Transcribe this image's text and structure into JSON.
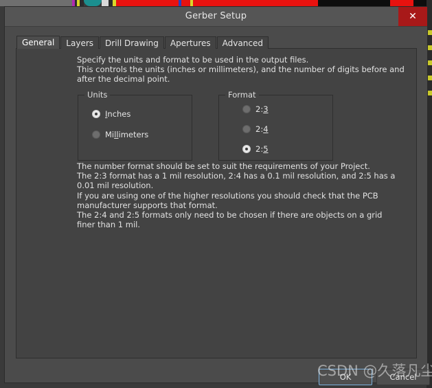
{
  "window": {
    "title": "Gerber Setup",
    "close_label": "✕",
    "close_icon": "close-icon"
  },
  "tabs": [
    {
      "label": "General",
      "active": true
    },
    {
      "label": "Layers",
      "active": false
    },
    {
      "label": "Drill Drawing",
      "active": false
    },
    {
      "label": "Apertures",
      "active": false
    },
    {
      "label": "Advanced",
      "active": false
    }
  ],
  "general": {
    "intro_text": "Specify the units and format to be used in the output files.\nThis controls the units (inches or millimeters), and the number of digits before and after the decimal point.",
    "detail_text": "The number format should be set to suit the requirements of your Project.\nThe 2:3 format has a 1 mil resolution, 2:4 has a 0.1 mil resolution, and 2:5 has a 0.01 mil resolution.\nIf you are using one of the higher resolutions you should check that the PCB manufacturer supports that format.\nThe 2:4 and 2:5 formats only need to be chosen if there are objects on a grid finer than 1 mil.",
    "units": {
      "legend": "Units",
      "options": [
        {
          "label": "Inches",
          "mnemonic": "I",
          "selected": true
        },
        {
          "label": "Millimeters",
          "mnemonic": "ll",
          "selected": false
        }
      ]
    },
    "format": {
      "legend": "Format",
      "options": [
        {
          "label": "2:3",
          "mnemonic": "3",
          "selected": false
        },
        {
          "label": "2:4",
          "mnemonic": "4",
          "selected": false
        },
        {
          "label": "2:5",
          "mnemonic": "5",
          "selected": true
        }
      ]
    }
  },
  "footer": {
    "ok_label": "OK",
    "cancel_label": "Cancel"
  },
  "watermark": {
    "text": "CSDN @久落凡尘"
  },
  "colors": {
    "dialog_background": "#4b4b4b",
    "panel_background": "#434343",
    "title_bar": "#555555",
    "close_button": "#a81919",
    "text": "#e2e2e2",
    "focus_border": "#7fb4e0",
    "backdrop_red": "#e8120f",
    "backdrop_teal": "#1b8f8f",
    "backdrop_yellow": "#c9c92a"
  }
}
